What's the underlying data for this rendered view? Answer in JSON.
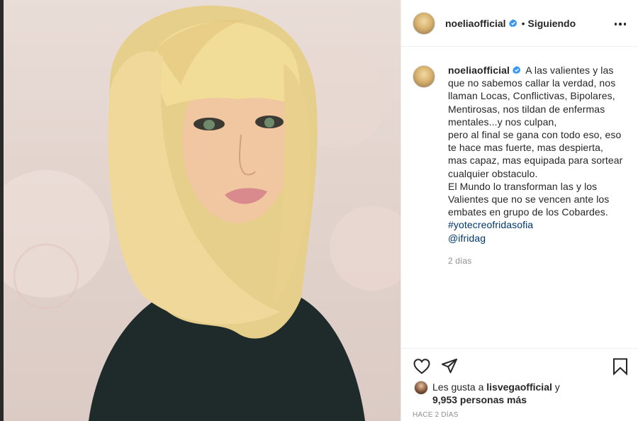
{
  "post": {
    "username": "noeliaofficial",
    "separator": "•",
    "follow_status": "Siguiendo",
    "caption_lines": [
      "A las valientes y las",
      "que no sabemos callar la verdad, nos",
      "llaman Locas, Conflictivas, Bipolares,",
      "Mentirosas, nos tildan de enfermas",
      "mentales...y nos culpan,",
      "pero al final se gana con todo eso, eso",
      "te hace mas fuerte, mas despierta,",
      "mas capaz, mas equipada para sortear",
      "cualquier obstaculo.",
      "El Mundo lo transforman las y los",
      "Valientes que no se vencen ante los",
      "embates en grupo de los Cobardes."
    ],
    "hashtag": "#yotecreofridasofia",
    "mention": "@ifridag",
    "comment_time": "2 días",
    "likes": {
      "prefix": "Les gusta a",
      "liker": "lisvegaofficial",
      "conjunction": "y",
      "count_text": "9,953 personas más"
    },
    "date": "HACE 2 DÍAS"
  },
  "icons": {
    "verified": "verified-badge-icon",
    "more": "more-options-icon",
    "like": "heart-icon",
    "share": "paper-plane-icon",
    "save": "bookmark-icon"
  },
  "colors": {
    "verified": "#3897f0",
    "hashtag": "#00376b",
    "muted": "#8e8e8e"
  }
}
